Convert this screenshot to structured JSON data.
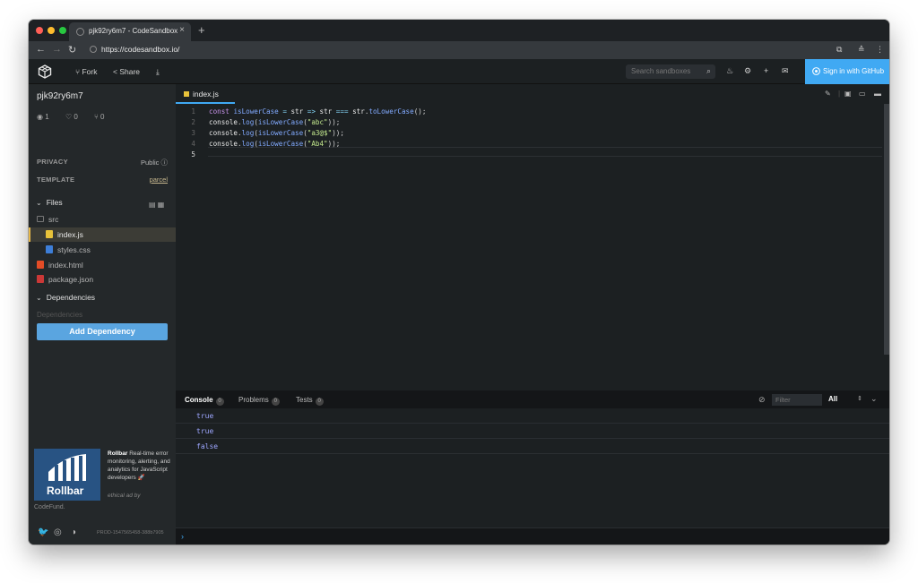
{
  "browser": {
    "tab_title": "pjk92ry6m7 - CodeSandbox",
    "tab_close": "×",
    "new_tab": "+",
    "url": "https://codesandbox.io/"
  },
  "header": {
    "fork_label": "Fork",
    "share_label": "Share",
    "search_placeholder": "Search sandboxes",
    "signin_label": "Sign in with GitHub",
    "accent_color": "#40a9f3"
  },
  "sidebar": {
    "sandbox_name": "pjk92ry6m7",
    "stats": {
      "views": "1",
      "likes": "0",
      "forks": "0"
    },
    "privacy_label": "PRIVACY",
    "privacy_value": "Public",
    "template_label": "TEMPLATE",
    "template_value": "parcel",
    "files_label": "Files",
    "files": [
      {
        "name": "src",
        "icon": "folder-icon"
      },
      {
        "name": "index.js",
        "icon": "js-file-icon"
      },
      {
        "name": "styles.css",
        "icon": "css-file-icon"
      },
      {
        "name": "index.html",
        "icon": "html-file-icon"
      },
      {
        "name": "package.json",
        "icon": "json-file-icon"
      }
    ],
    "dependencies_label": "Dependencies",
    "dependencies_placeholder": "Dependencies",
    "add_dependency_label": "Add Dependency",
    "ad": {
      "image_text": "Rollbar",
      "brand": "Rollbar",
      "text": "Real-time error monitoring, alerting, and analytics for JavaScript developers",
      "ethical": "ethical ad by",
      "codefund": "CodeFund."
    },
    "version": "PROD-1547565458-388b7905"
  },
  "editor": {
    "active_tab": "index.js",
    "line_numbers": [
      "1",
      "2",
      "3",
      "4",
      "5"
    ]
  },
  "console": {
    "tabs": [
      {
        "label": "Console",
        "count": "0"
      },
      {
        "label": "Problems",
        "count": "0"
      },
      {
        "label": "Tests",
        "count": "0"
      }
    ],
    "filter_placeholder": "Filter",
    "level": "All",
    "logs": [
      "true",
      "true",
      "false"
    ],
    "prompt": "›"
  }
}
